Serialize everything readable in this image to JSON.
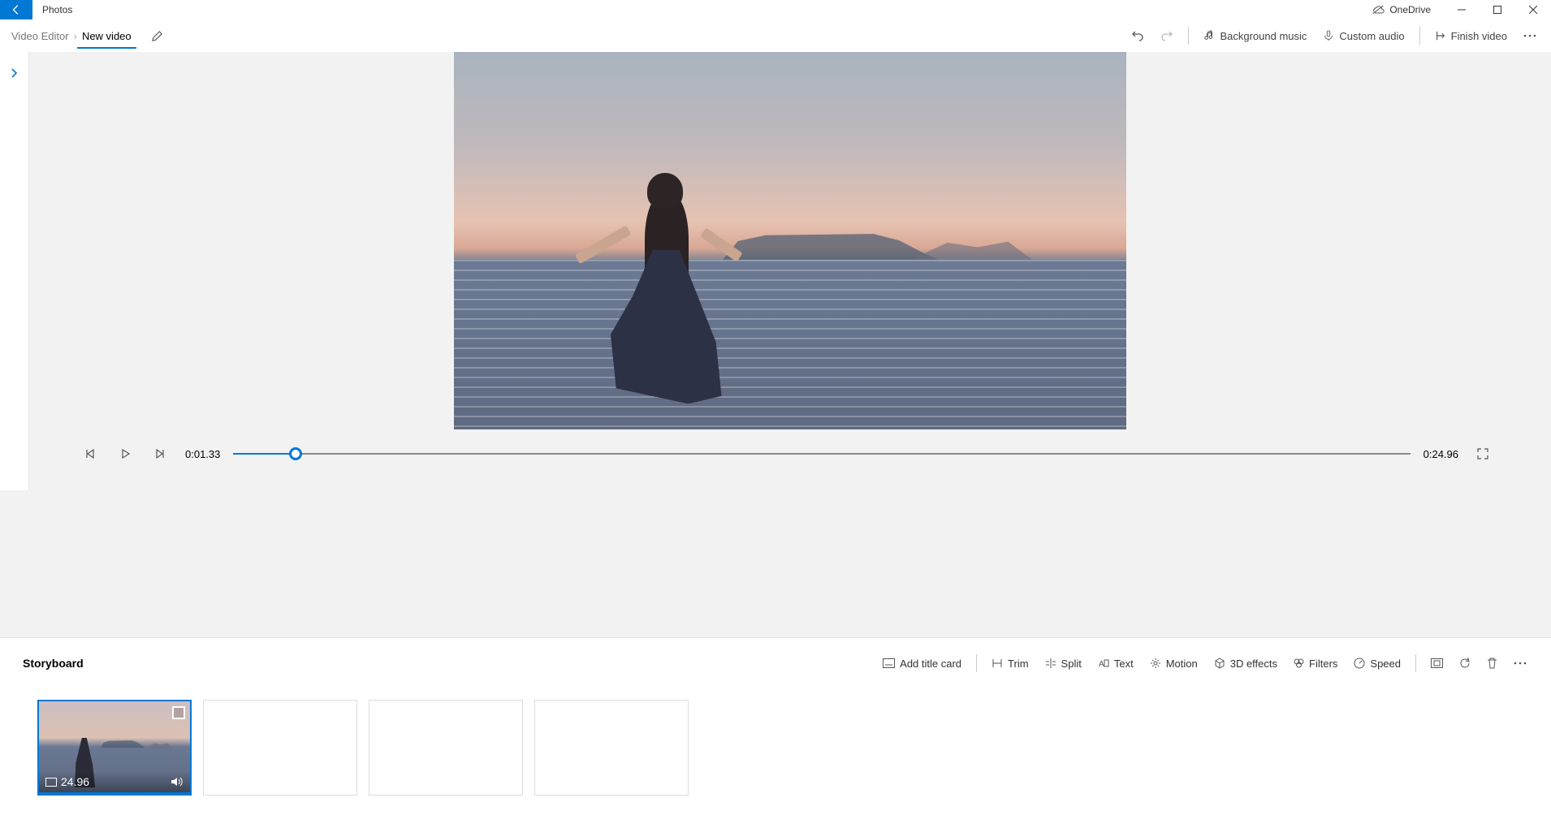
{
  "titlebar": {
    "app": "Photos",
    "cloud": "OneDrive"
  },
  "breadcrumb": {
    "root": "Video Editor",
    "current": "New video"
  },
  "toolbar": {
    "bg_music": "Background music",
    "custom_audio": "Custom audio",
    "finish": "Finish video"
  },
  "preview": {
    "current_time": "0:01.33",
    "total_time": "0:24.96"
  },
  "storyboard": {
    "title": "Storyboard",
    "add_title": "Add title card",
    "trim": "Trim",
    "split": "Split",
    "text": "Text",
    "motion": "Motion",
    "effects": "3D effects",
    "filters": "Filters",
    "speed": "Speed"
  },
  "clip": {
    "duration": "24.96"
  }
}
